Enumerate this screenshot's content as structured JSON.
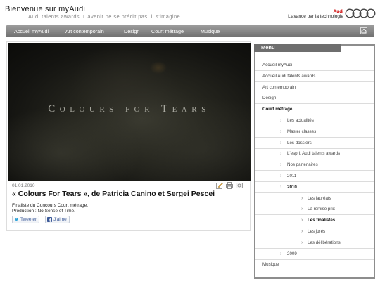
{
  "header": {
    "title": "Bienvenue sur myAudi",
    "tagline": "Audi talents awards. L'avenir ne se prédit pas, il s'imagine.",
    "brand": "Audi",
    "slogan": "L'avance par la technologie"
  },
  "nav": {
    "items": [
      {
        "label": "Accueil myAudi"
      },
      {
        "label": "Art contemporain"
      },
      {
        "label": "Design"
      },
      {
        "label": "Court métrage"
      },
      {
        "label": "Musique"
      }
    ]
  },
  "video": {
    "title": "Colours for Tears"
  },
  "post": {
    "date": "01.01.2010",
    "title": "« Colours For Tears », de Patricia Canino et Sergei Pescei",
    "body_line1": "Finaliste du Concours Court métrage.",
    "body_line2": "Production : No Sense of Time.",
    "tweet_label": "Tweeter",
    "like_label": "J'aime"
  },
  "menu": {
    "header": "Menu",
    "items": [
      {
        "label": "Accueil myAudi",
        "level": 0
      },
      {
        "label": "Accueil Audi talents awards",
        "level": 0
      },
      {
        "label": "Art contemporain",
        "level": 0
      },
      {
        "label": "Design",
        "level": 0
      },
      {
        "label": "Court métrage",
        "level": 0,
        "active": true
      },
      {
        "label": "Les actualités",
        "level": 1
      },
      {
        "label": "Master classes",
        "level": 1
      },
      {
        "label": "Les dossiers",
        "level": 1
      },
      {
        "label": "L'esprit Audi talents awards",
        "level": 1
      },
      {
        "label": "Nos partenaires",
        "level": 1
      },
      {
        "label": "2011",
        "level": 1
      },
      {
        "label": "2010",
        "level": 1,
        "active": true
      },
      {
        "label": "Les lauréats",
        "level": 2
      },
      {
        "label": "La remise prix",
        "level": 2
      },
      {
        "label": "Les finalistes",
        "level": 2,
        "active": true
      },
      {
        "label": "Les jurés",
        "level": 2
      },
      {
        "label": "Les délibérations",
        "level": 2
      },
      {
        "label": "2009",
        "level": 1
      },
      {
        "label": "Musique",
        "level": 0
      }
    ]
  },
  "colors": {
    "nav_gradient_top": "#9c9c9c",
    "nav_gradient_bottom": "#6f6f6f",
    "audi_red": "#cc0000",
    "menu_header_bg": "#6e6e6e"
  },
  "icons": {
    "home": "home-icon",
    "edit": "edit-icon",
    "print": "print-icon",
    "email": "email-icon",
    "twitter": "twitter-icon",
    "facebook": "facebook-icon",
    "rings": "audi-rings-logo"
  }
}
